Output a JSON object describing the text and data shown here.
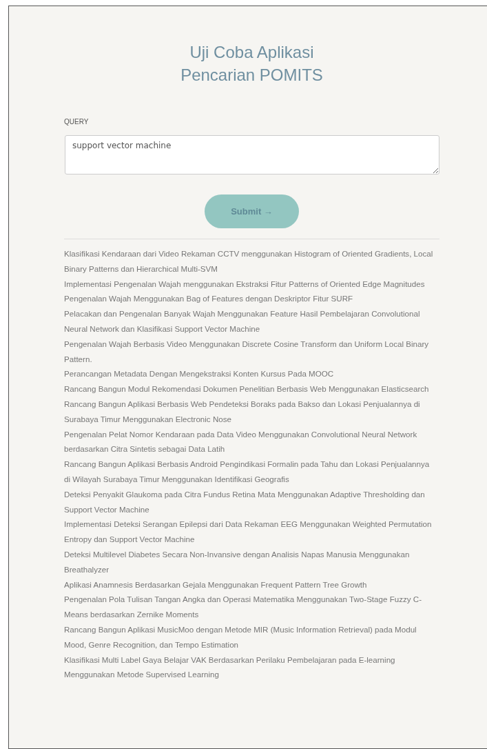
{
  "title_lines": [
    "Uji Coba Aplikasi",
    "Pencarian POMITS"
  ],
  "query": {
    "label": "QUERY",
    "value": "support vector machine"
  },
  "submit": {
    "label": "Submit",
    "arrow": "→"
  },
  "results": [
    "Klasifikasi Kendaraan dari Video Rekaman CCTV menggunakan Histogram of Oriented Gradients, Local Binary Patterns dan Hierarchical Multi-SVM",
    "Implementasi Pengenalan Wajah menggunakan Ekstraksi Fitur Patterns of Oriented Edge Magnitudes",
    "Pengenalan Wajah Menggunakan Bag of Features dengan Deskriptor Fitur SURF",
    "Pelacakan dan Pengenalan Banyak Wajah Menggunakan Feature Hasil Pembelajaran Convolutional Neural Network dan Klasifikasi Support Vector Machine",
    "Pengenalan Wajah Berbasis Video Menggunakan Discrete Cosine Transform dan Uniform Local Binary Pattern.",
    "Perancangan Metadata Dengan Mengekstraksi Konten Kursus Pada MOOC",
    "Rancang Bangun Modul Rekomendasi Dokumen Penelitian Berbasis Web Menggunakan Elasticsearch",
    "Rancang Bangun Aplikasi Berbasis Web Pendeteksi Boraks pada Bakso dan Lokasi Penjualannya di Surabaya Timur Menggunakan Electronic Nose",
    "Pengenalan Pelat Nomor Kendaraan pada Data Video Menggunakan Convolutional Neural Network berdasarkan Citra Sintetis sebagai Data Latih",
    "Rancang Bangun Aplikasi Berbasis Android Pengindikasi Formalin pada Tahu dan Lokasi Penjualannya di Wilayah Surabaya Timur Menggunakan Identifikasi Geografis",
    "Deteksi Penyakit Glaukoma pada Citra Fundus Retina Mata Menggunakan Adaptive Thresholding dan Support Vector Machine",
    "Implementasi Deteksi Serangan Epilepsi dari Data Rekaman EEG Menggunakan Weighted Permutation Entropy dan Support Vector Machine",
    "Deteksi Multilevel Diabetes Secara Non-Invansive dengan Analisis Napas Manusia Menggunakan Breathalyzer",
    "Aplikasi Anamnesis Berdasarkan Gejala Menggunakan Frequent Pattern Tree Growth",
    "Pengenalan Pola Tulisan Tangan Angka dan Operasi Matematika Menggunakan Two-Stage Fuzzy C-Means berdasarkan Zernike Moments",
    "Rancang Bangun Aplikasi MusicMoo dengan Metode MIR (Music Information Retrieval) pada Modul Mood, Genre Recognition, dan Tempo Estimation",
    "Klasifikasi Multi Label Gaya Belajar VAK Berdasarkan Perilaku Pembelajaran pada E-learning Menggunakan Metode Supervised Learning"
  ]
}
